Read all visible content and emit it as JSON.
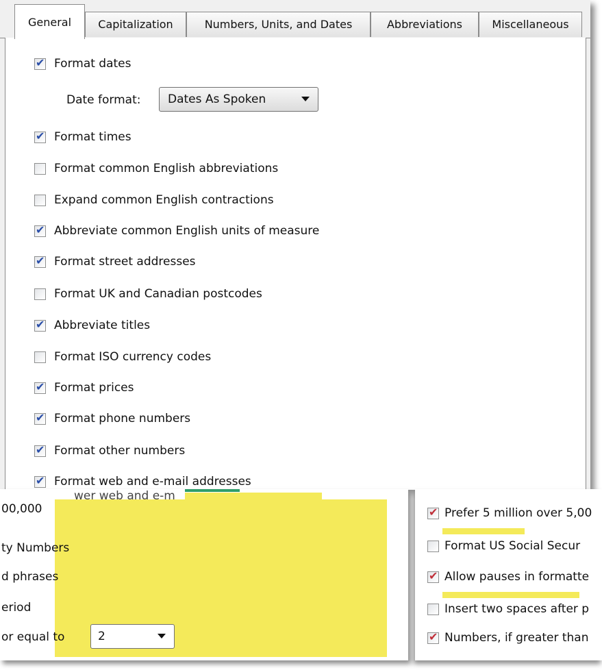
{
  "tabs": [
    {
      "label": "General"
    },
    {
      "label": "Capitalization"
    },
    {
      "label": "Numbers, Units, and Dates"
    },
    {
      "label": "Abbreviations"
    },
    {
      "label": "Miscellaneous"
    }
  ],
  "active_tab": "General",
  "options": [
    {
      "label": "Format dates",
      "checked": true
    },
    {
      "label": "Format times",
      "checked": true
    },
    {
      "label": "Format common English abbreviations",
      "checked": false
    },
    {
      "label": "Expand common English contractions",
      "checked": false
    },
    {
      "label": "Abbreviate common English units of measure",
      "checked": true
    },
    {
      "label": "Format street addresses",
      "checked": true
    },
    {
      "label": "Format UK and Canadian postcodes",
      "checked": false
    },
    {
      "label": "Abbreviate titles",
      "checked": true
    },
    {
      "label": "Format ISO currency codes",
      "checked": false
    },
    {
      "label": "Format prices",
      "checked": true
    },
    {
      "label": "Format phone numbers",
      "checked": true
    },
    {
      "label": "Format other numbers",
      "checked": true
    },
    {
      "label": "Format web and e-mail addresses",
      "checked": true
    }
  ],
  "date_format": {
    "label": "Date format:",
    "value": "Dates As Spoken"
  },
  "overlay_left": {
    "lines": [
      "00,000",
      "ty Numbers",
      "d phrases",
      "eriod",
      "or equal to"
    ],
    "select_value": "2",
    "cut_text": "wer web and e-m"
  },
  "overlay_right": {
    "options": [
      {
        "label": "Prefer 5 million over 5,00",
        "checked": true
      },
      {
        "label": "Format US Social Secur",
        "checked": false
      },
      {
        "label": "Allow pauses in formatte",
        "checked": true
      },
      {
        "label": "Insert two spaces after p",
        "checked": false
      },
      {
        "label": "Numbers, if greater than",
        "checked": true
      }
    ]
  },
  "colors": {
    "highlight": "#f4ea5a",
    "check_blue": "#2a4ea8",
    "check_red": "#c0303a"
  }
}
